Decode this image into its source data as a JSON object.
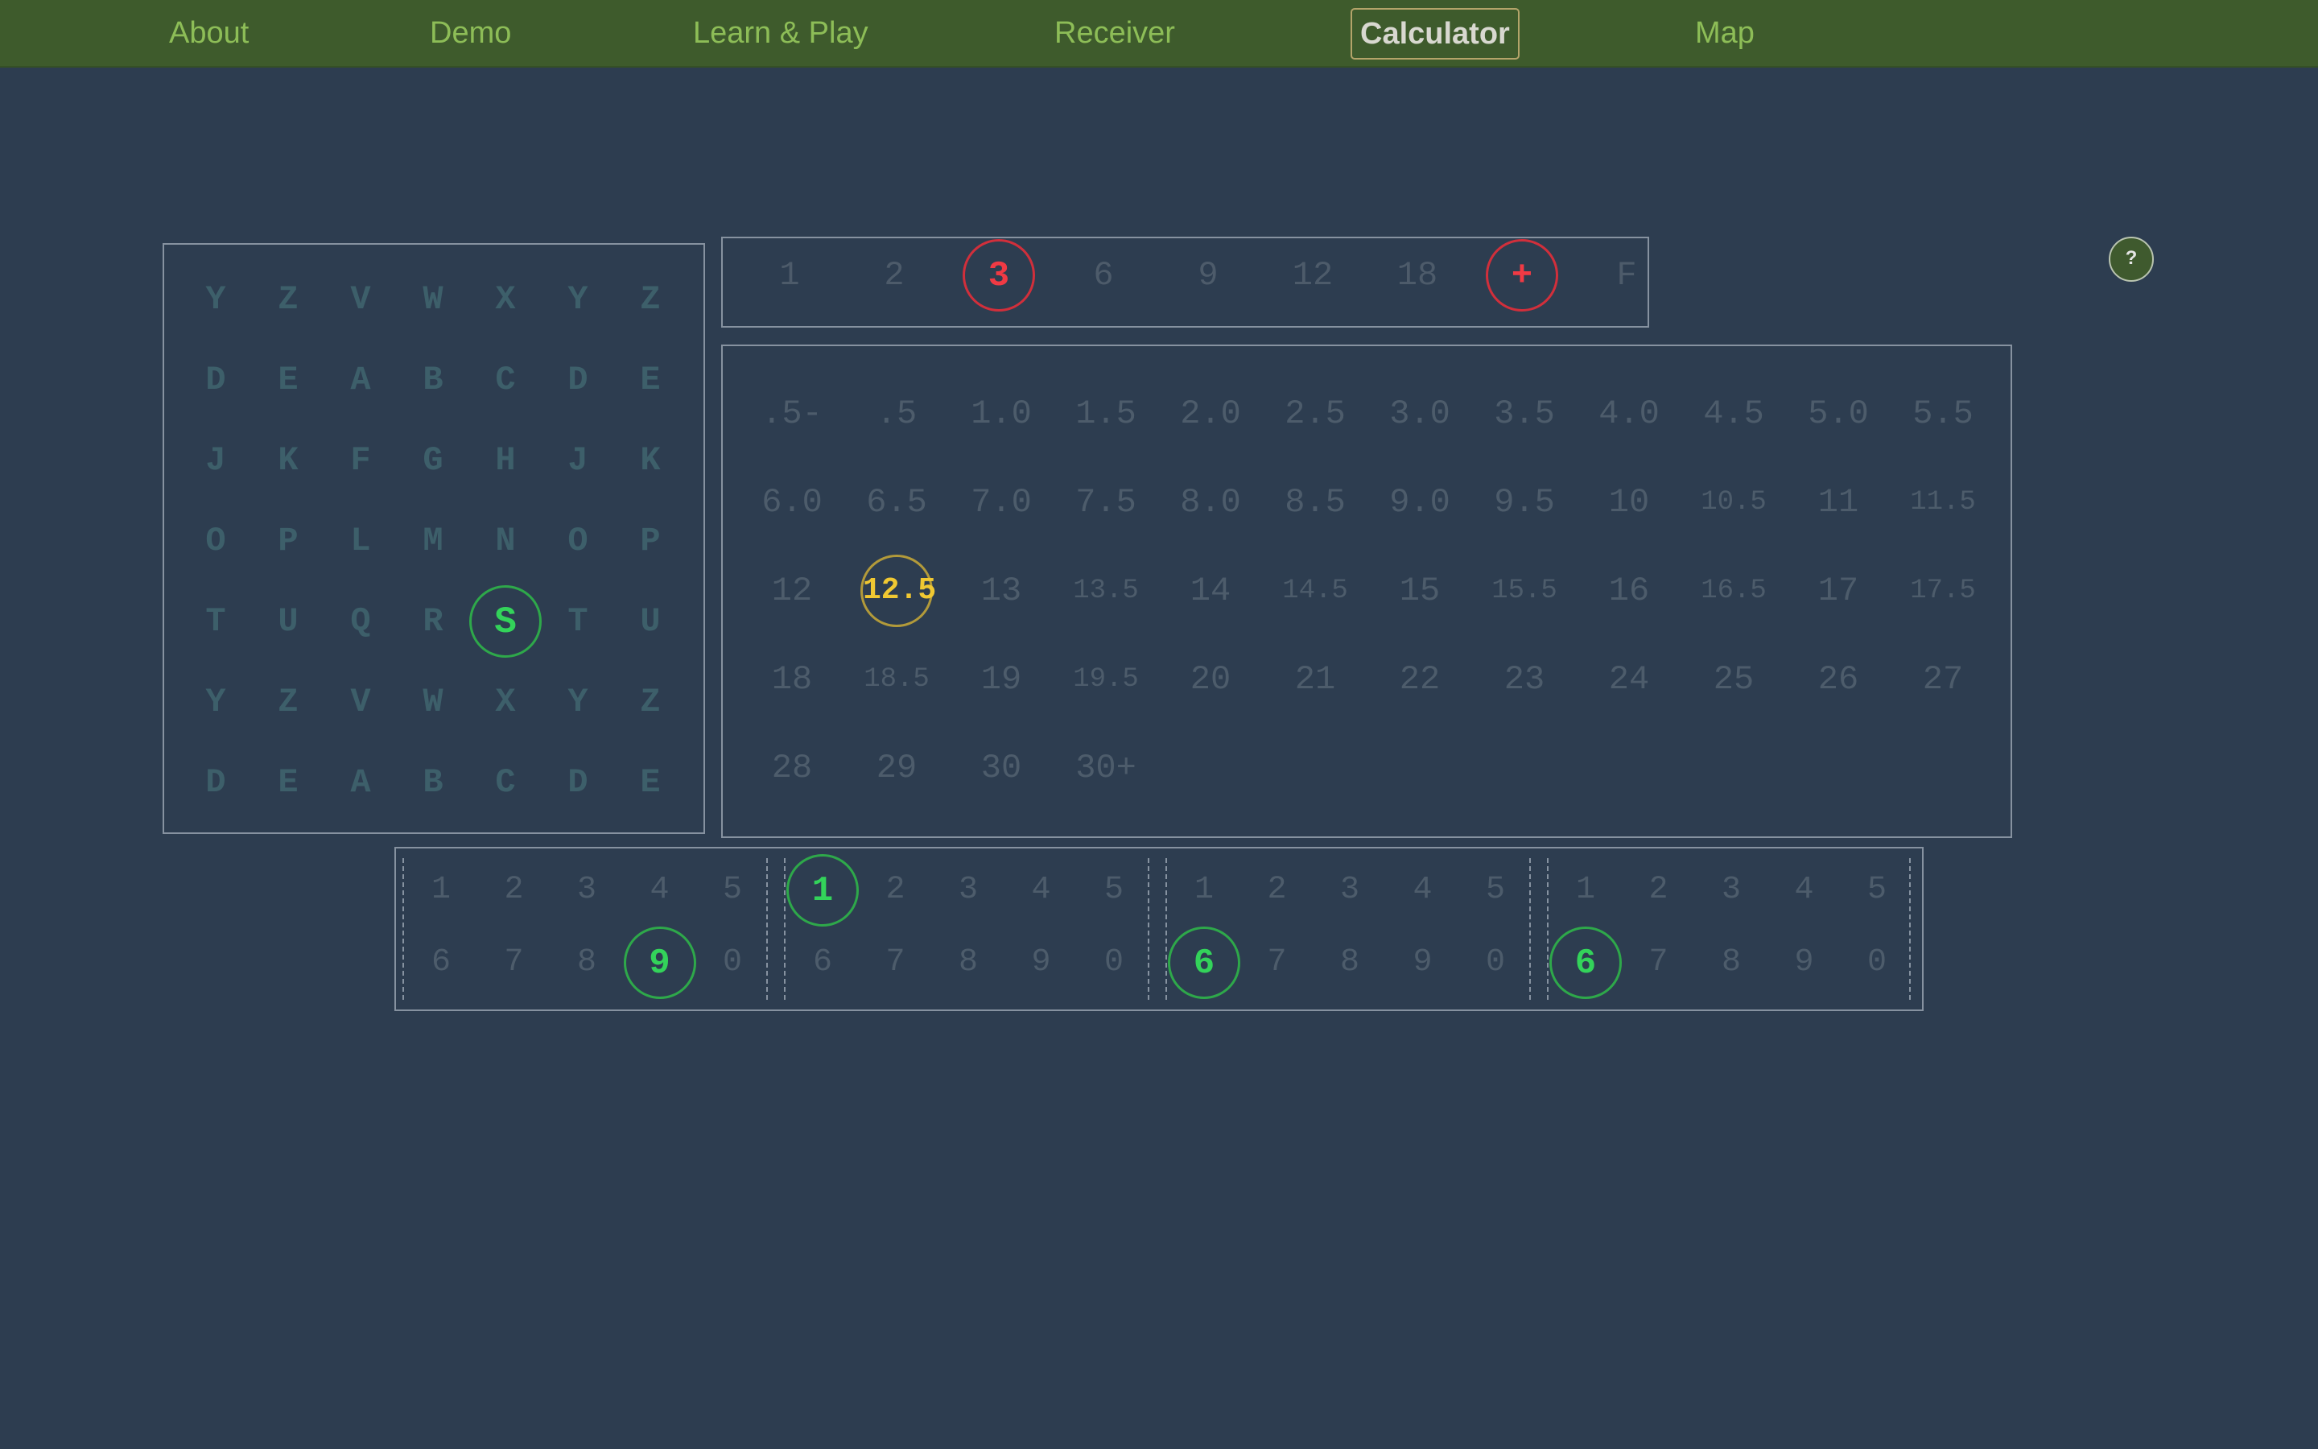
{
  "nav": {
    "items": [
      {
        "label": "About"
      },
      {
        "label": "Demo"
      },
      {
        "label": "Learn & Play"
      },
      {
        "label": "Receiver"
      },
      {
        "label": "Calculator",
        "active": true
      },
      {
        "label": "Map"
      }
    ]
  },
  "help": {
    "label": "?"
  },
  "letter_grid": {
    "rows": [
      [
        "Y",
        "Z",
        "V",
        "W",
        "X",
        "Y",
        "Z"
      ],
      [
        "D",
        "E",
        "A",
        "B",
        "C",
        "D",
        "E"
      ],
      [
        "J",
        "K",
        "F",
        "G",
        "H",
        "J",
        "K"
      ],
      [
        "O",
        "P",
        "L",
        "M",
        "N",
        "O",
        "P"
      ],
      [
        "T",
        "U",
        "Q",
        "R",
        "S",
        "T",
        "U"
      ],
      [
        "Y",
        "Z",
        "V",
        "W",
        "X",
        "Y",
        "Z"
      ],
      [
        "D",
        "E",
        "A",
        "B",
        "C",
        "D",
        "E"
      ]
    ],
    "selected": {
      "row": 4,
      "col": 4
    }
  },
  "top_selector": {
    "items": [
      "1",
      "2",
      "3",
      "6",
      "9",
      "12",
      "18",
      "+",
      "F"
    ],
    "selected": [
      "3",
      "+"
    ]
  },
  "value_grid": {
    "rows": [
      [
        ".5-",
        ".5",
        "1.0",
        "1.5",
        "2.0",
        "2.5",
        "3.0",
        "3.5",
        "4.0",
        "4.5",
        "5.0",
        "5.5"
      ],
      [
        "6.0",
        "6.5",
        "7.0",
        "7.5",
        "8.0",
        "8.5",
        "9.0",
        "9.5",
        "10",
        "10.5",
        "11",
        "11.5"
      ],
      [
        "12",
        "12.5",
        "13",
        "13.5",
        "14",
        "14.5",
        "15",
        "15.5",
        "16",
        "16.5",
        "17",
        "17.5"
      ],
      [
        "18",
        "18.5",
        "19",
        "19.5",
        "20",
        "21",
        "22",
        "23",
        "24",
        "25",
        "26",
        "27"
      ],
      [
        "28",
        "29",
        "30",
        "30+"
      ]
    ],
    "selected": "12.5"
  },
  "digit_panel": {
    "groups": [
      {
        "top": [
          "1",
          "2",
          "3",
          "4",
          "5"
        ],
        "bottom": [
          "6",
          "7",
          "8",
          "9",
          "0"
        ],
        "selected": "9"
      },
      {
        "top": [
          "1",
          "2",
          "3",
          "4",
          "5"
        ],
        "bottom": [
          "6",
          "7",
          "8",
          "9",
          "0"
        ],
        "selected": "1"
      },
      {
        "top": [
          "1",
          "2",
          "3",
          "4",
          "5"
        ],
        "bottom": [
          "6",
          "7",
          "8",
          "9",
          "0"
        ],
        "selected": "6"
      },
      {
        "top": [
          "1",
          "2",
          "3",
          "4",
          "5"
        ],
        "bottom": [
          "6",
          "7",
          "8",
          "9",
          "0"
        ],
        "selected": "6"
      }
    ]
  },
  "colors": {
    "background": "#2d3d50",
    "nav_bar": "#3e5b2c",
    "nav_text": "#8dbd57",
    "green_select": "#33d35a",
    "red_select": "#f03a44",
    "yellow_select": "#f0c832"
  }
}
